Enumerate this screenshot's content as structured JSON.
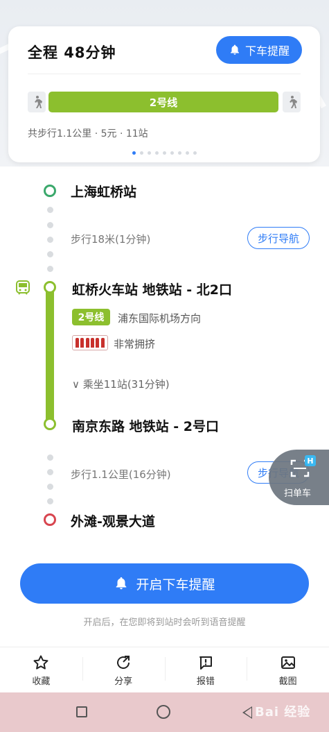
{
  "summary": {
    "total": "全程  48分钟",
    "remind_button": "下车提醒",
    "line_name": "2号线",
    "meta": "共步行1.1公里 · 5元 · 11站",
    "page_count": 9,
    "active_page": 0
  },
  "route": {
    "start_station": "上海虹桥站",
    "walk1": "步行18米(1分钟)",
    "walk_nav": "步行导航",
    "board_station": "虹桥火车站 地铁站 - 北2口",
    "line_tag": "2号线",
    "direction": "浦东国际机场方向",
    "crowd": "非常拥挤",
    "ride_info": "∨ 乘坐11站(31分钟)",
    "alight_station": "南京东路 地铁站 - 2号口",
    "walk2": "步行1.1公里(16分钟)",
    "walk_nav2": "步行导航",
    "end_station": "外滩-观景大道"
  },
  "scan": {
    "label": "扫单车",
    "badge": "H"
  },
  "action": {
    "main_button": "开启下车提醒",
    "hint": "开启后，在您即将到站时会听到语音提醒"
  },
  "toolbar": {
    "items": [
      "收藏",
      "分享",
      "报错",
      "截图"
    ]
  },
  "watermark": "Bai 经验",
  "colors": {
    "accent": "#2f7cf6",
    "line_green": "#8cbf2e",
    "start_ring": "#3aa86b",
    "end_ring": "#d8454f",
    "crowd_red": "#c8302c"
  }
}
